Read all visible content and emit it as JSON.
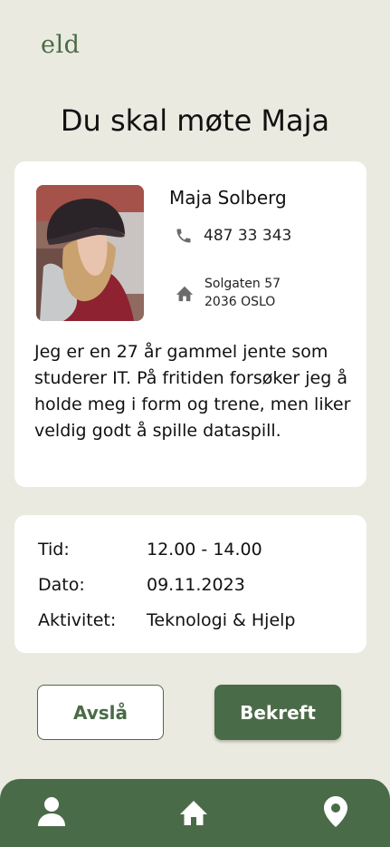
{
  "app": {
    "logo": "eld"
  },
  "page": {
    "title": "Du skal møte Maja"
  },
  "profile": {
    "name": "Maja Solberg",
    "phone": "487 33 343",
    "address_line1": "Solgaten 57",
    "address_line2": "2036 OSLO",
    "bio": "Jeg er en 27 år gammel jente som studerer IT. På fritiden forsøker jeg å holde meg i form og trene, men liker veldig godt å spille dataspill.",
    "phone_icon": "phone-icon",
    "address_icon": "home-icon"
  },
  "details": [
    {
      "label": "Tid:",
      "value": "12.00 - 14.00"
    },
    {
      "label": "Dato:",
      "value": "09.11.2023"
    },
    {
      "label": "Aktivitet:",
      "value": "Teknologi & Hjelp"
    }
  ],
  "actions": {
    "decline_label": "Avslå",
    "confirm_label": "Bekreft"
  },
  "nav": {
    "items": [
      "person-icon",
      "home-icon",
      "location-pin-icon"
    ]
  },
  "colors": {
    "accent": "#4a6b47",
    "background": "#eaeae0",
    "card": "#ffffff"
  }
}
